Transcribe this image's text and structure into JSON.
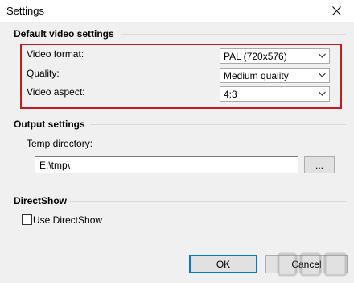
{
  "window": {
    "title": "Settings"
  },
  "video_group": {
    "title": "Default video settings",
    "rows": [
      {
        "label": "Video format:",
        "value": "PAL (720x576)"
      },
      {
        "label": "Quality:",
        "value": "Medium quality"
      },
      {
        "label": "Video aspect:",
        "value": "4:3"
      }
    ]
  },
  "output_group": {
    "title": "Output settings",
    "temp_label": "Temp directory:",
    "temp_value": "E:\\tmp\\",
    "browse_label": "..."
  },
  "directshow_group": {
    "title": "DirectShow",
    "checkbox_label": "Use DirectShow",
    "checked": false
  },
  "buttons": {
    "ok": "OK",
    "cancel": "Cancel"
  },
  "colors": {
    "highlight": "#c8191f",
    "accent": "#0078d7"
  }
}
